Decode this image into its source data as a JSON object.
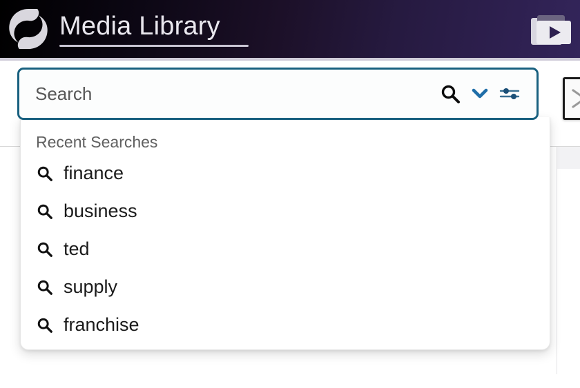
{
  "header": {
    "title": "Media Library",
    "logo_icon": "spiral-swirl-logo",
    "media_icon": "media-folder-play-icon"
  },
  "search": {
    "value": "",
    "placeholder": "Search",
    "search_icon": "search-icon",
    "expand_icon": "chevron-down-icon",
    "filter_icon": "filter-sliders-icon"
  },
  "edge_button": {
    "icon": "chevron-right-icon"
  },
  "dropdown": {
    "heading": "Recent Searches",
    "items": [
      {
        "label": "finance",
        "icon": "search-icon"
      },
      {
        "label": "business",
        "icon": "search-icon"
      },
      {
        "label": "ted",
        "icon": "search-icon"
      },
      {
        "label": "supply",
        "icon": "search-icon"
      },
      {
        "label": "franchise",
        "icon": "search-icon"
      }
    ]
  },
  "colors": {
    "header_start": "#000000",
    "header_end": "#33255a",
    "search_border": "#18607f",
    "accent_blue": "#1f6ea8",
    "heading_gray": "#606060"
  }
}
